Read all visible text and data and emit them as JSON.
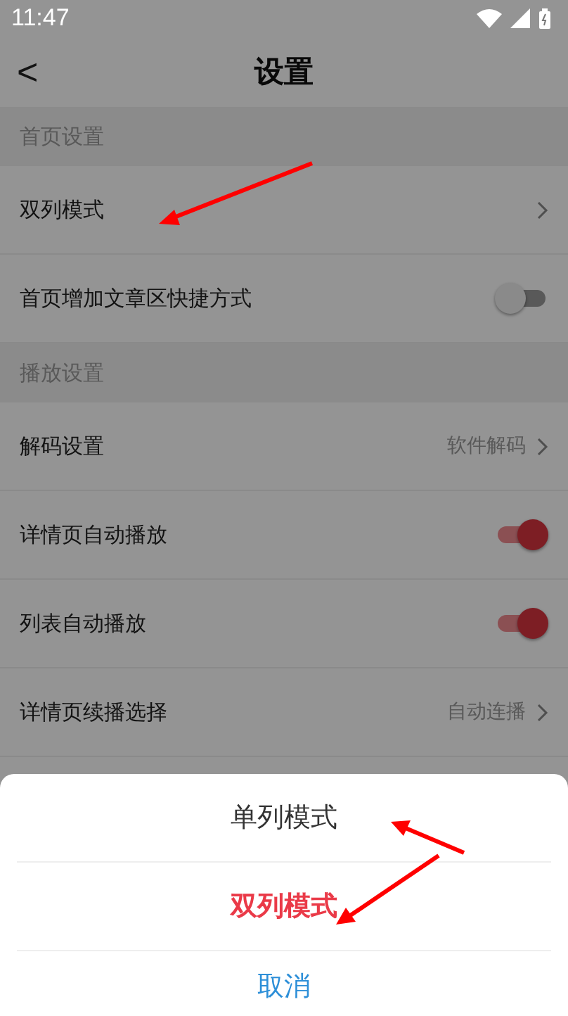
{
  "status_bar": {
    "time": "11:47"
  },
  "header": {
    "back": "<",
    "title": "设置"
  },
  "sections": [
    {
      "title": "首页设置",
      "items": [
        {
          "kind": "nav",
          "label": "双列模式"
        },
        {
          "kind": "toggle",
          "label": "首页增加文章区快捷方式",
          "on": false
        }
      ]
    },
    {
      "title": "播放设置",
      "items": [
        {
          "kind": "nav",
          "label": "解码设置",
          "value": "软件解码"
        },
        {
          "kind": "toggle",
          "label": "详情页自动播放",
          "on": true
        },
        {
          "kind": "toggle",
          "label": "列表自动播放",
          "on": true
        },
        {
          "kind": "nav",
          "label": "详情页续播选择",
          "value": "自动连播"
        }
      ]
    }
  ],
  "sheet": {
    "options": [
      {
        "label": "单列模式",
        "selected": false
      },
      {
        "label": "双列模式",
        "selected": true
      }
    ],
    "cancel": "取消"
  }
}
